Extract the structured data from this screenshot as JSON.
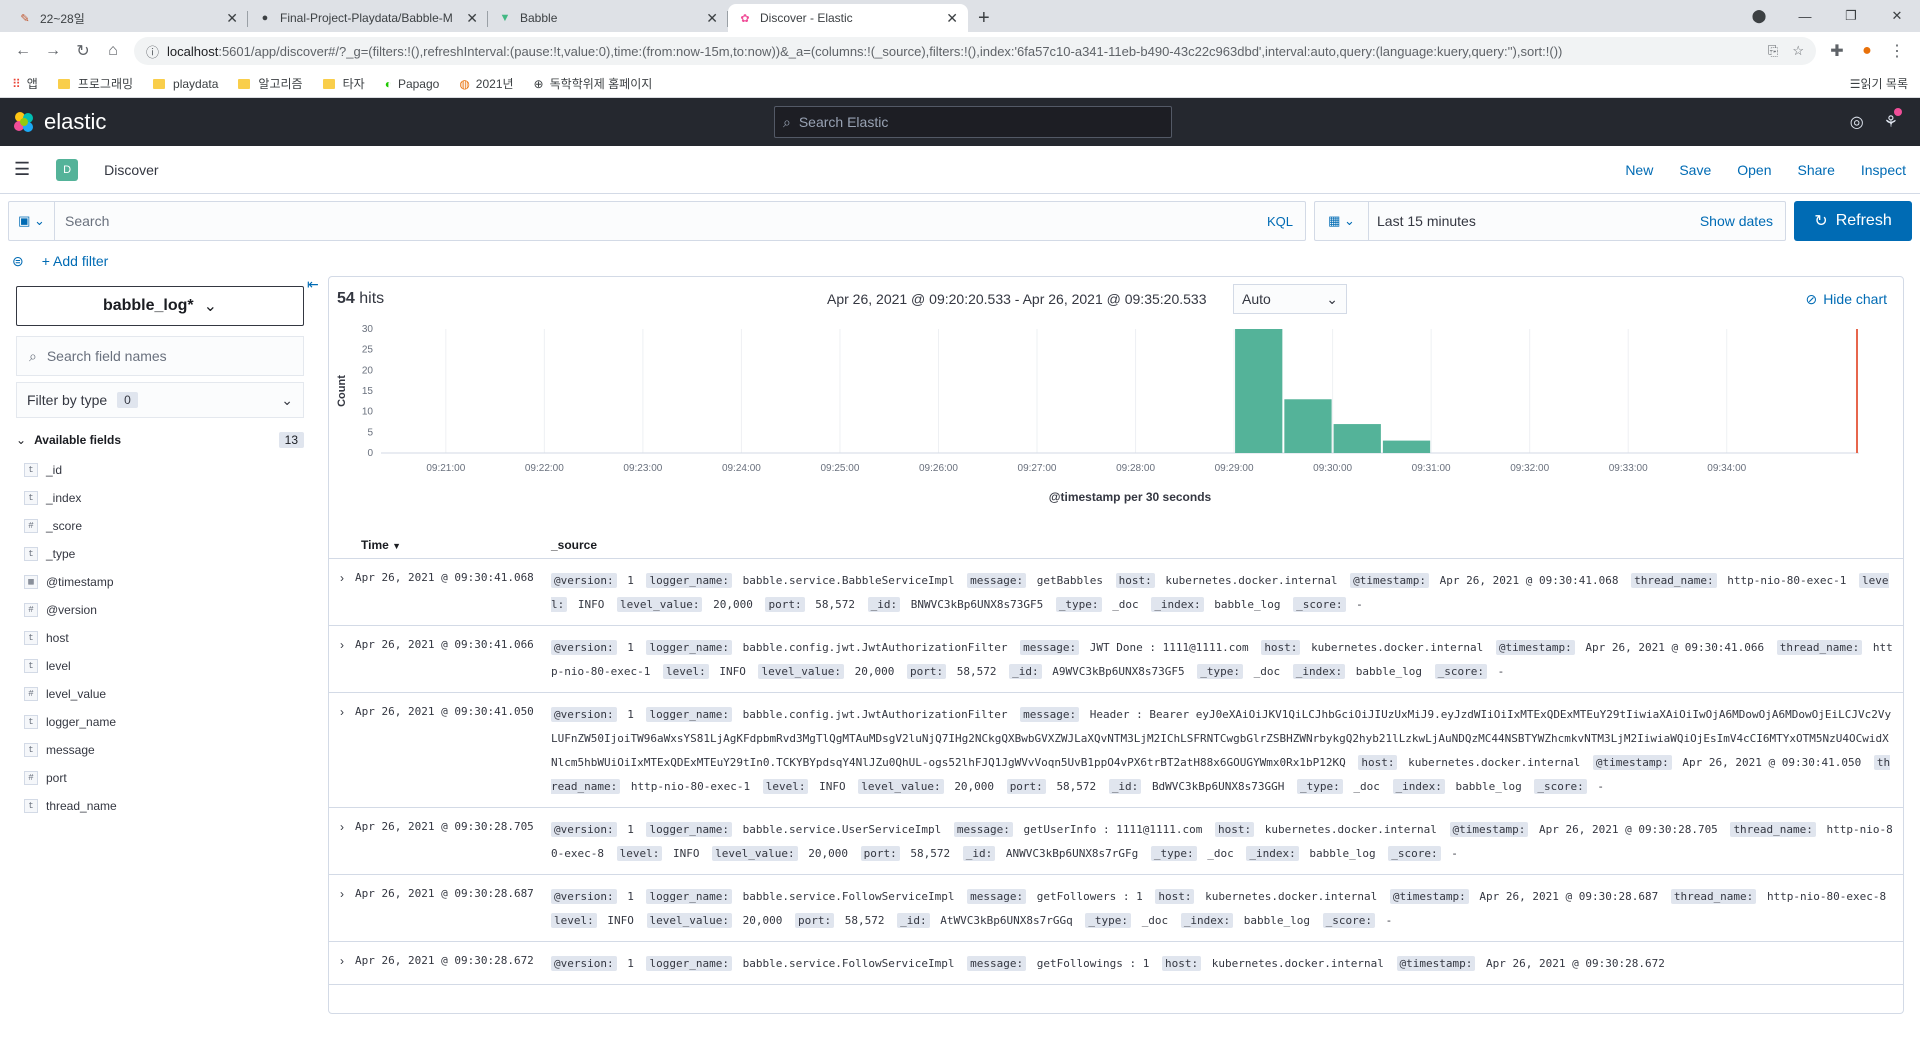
{
  "browser": {
    "tabs": [
      {
        "title": "22~28일",
        "icon": "paint-icon"
      },
      {
        "title": "Final-Project-Playdata/Babble-M",
        "icon": "github-icon"
      },
      {
        "title": "Babble",
        "icon": "vue-icon"
      },
      {
        "title": "Discover - Elastic",
        "icon": "elastic-icon",
        "active": true
      }
    ],
    "url_host": "localhost",
    "url_rest": ":5601/app/discover#/?_g=(filters:!(),refreshInterval:(pause:!t,value:0),time:(from:now-15m,to:now))&_a=(columns:!(_source),filters:!(),index:'6fa57c10-a341-11eb-b490-43c22c963dbd',interval:auto,query:(language:kuery,query:''),sort:!())",
    "bookmarks": [
      "앱",
      "프로그래밍",
      "playdata",
      "알고리즘",
      "타자",
      "Papago",
      "2021년",
      "독학학위제 홈페이지"
    ],
    "reading_list": "읽기 목록"
  },
  "kibana": {
    "logo_text": "elastic",
    "search_placeholder": "Search Elastic",
    "app_badge": "D",
    "breadcrumb": "Discover",
    "top_nav": [
      "New",
      "Save",
      "Open",
      "Share",
      "Inspect"
    ],
    "query_placeholder": "Search",
    "query_language": "KQL",
    "time_range": "Last 15 minutes",
    "show_dates": "Show dates",
    "refresh": "Refresh",
    "add_filter": "+ Add filter"
  },
  "sidebar": {
    "index_pattern": "babble_log*",
    "field_search_placeholder": "Search field names",
    "filter_by_type": "Filter by type",
    "filter_count": "0",
    "available_fields_label": "Available fields",
    "available_count": "13",
    "fields": [
      {
        "type": "t",
        "name": "_id"
      },
      {
        "type": "t",
        "name": "_index"
      },
      {
        "type": "#",
        "name": "_score"
      },
      {
        "type": "t",
        "name": "_type"
      },
      {
        "type": "▦",
        "name": "@timestamp"
      },
      {
        "type": "#",
        "name": "@version"
      },
      {
        "type": "t",
        "name": "host"
      },
      {
        "type": "t",
        "name": "level"
      },
      {
        "type": "#",
        "name": "level_value"
      },
      {
        "type": "t",
        "name": "logger_name"
      },
      {
        "type": "t",
        "name": "message"
      },
      {
        "type": "#",
        "name": "port"
      },
      {
        "type": "t",
        "name": "thread_name"
      }
    ]
  },
  "results": {
    "hits_count": "54",
    "hits_label": "hits",
    "range_text": "Apr 26, 2021 @ 09:20:20.533 - Apr 26, 2021 @ 09:35:20.533",
    "interval": "Auto",
    "hide_chart": "Hide chart",
    "col_time": "Time",
    "col_source": "_source"
  },
  "chart_data": {
    "type": "bar",
    "ylabel": "Count",
    "xlabel": "@timestamp per 30 seconds",
    "ylim": [
      0,
      30
    ],
    "yticks": [
      0,
      5,
      10,
      15,
      20,
      25,
      30
    ],
    "xticks": [
      "09:21:00",
      "09:22:00",
      "09:23:00",
      "09:24:00",
      "09:25:00",
      "09:26:00",
      "09:27:00",
      "09:28:00",
      "09:29:00",
      "09:30:00",
      "09:31:00",
      "09:32:00",
      "09:33:00",
      "09:34:00"
    ],
    "bars": [
      {
        "x": "09:29:00",
        "value": 31
      },
      {
        "x": "09:29:30",
        "value": 13
      },
      {
        "x": "09:30:00",
        "value": 7
      },
      {
        "x": "09:30:30",
        "value": 3
      }
    ],
    "now_marker": "09:35:20.533",
    "color": "#54b399"
  },
  "docs": [
    {
      "time": "Apr 26, 2021 @ 09:30:41.068",
      "fields": [
        [
          "@version:",
          "1"
        ],
        [
          "logger_name:",
          "babble.service.BabbleServiceImpl"
        ],
        [
          "message:",
          "getBabbles"
        ],
        [
          "host:",
          "kubernetes.docker.internal"
        ],
        [
          "@timestamp:",
          "Apr 26, 2021 @ 09:30:41.068"
        ],
        [
          "thread_name:",
          "http-nio-80-exec-1"
        ],
        [
          "level:",
          "INFO"
        ],
        [
          "level_value:",
          "20,000"
        ],
        [
          "port:",
          "58,572"
        ],
        [
          "_id:",
          "BNWVC3kBp6UNX8s73GF5"
        ],
        [
          "_type:",
          "_doc"
        ],
        [
          "_index:",
          "babble_log"
        ],
        [
          "_score:",
          "-"
        ]
      ]
    },
    {
      "time": "Apr 26, 2021 @ 09:30:41.066",
      "fields": [
        [
          "@version:",
          "1"
        ],
        [
          "logger_name:",
          "babble.config.jwt.JwtAuthorizationFilter"
        ],
        [
          "message:",
          "JWT Done : 1111@1111.com"
        ],
        [
          "host:",
          "kubernetes.docker.internal"
        ],
        [
          "@timestamp:",
          "Apr 26, 2021 @ 09:30:41.066"
        ],
        [
          "thread_name:",
          "http-nio-80-exec-1"
        ],
        [
          "level:",
          "INFO"
        ],
        [
          "level_value:",
          "20,000"
        ],
        [
          "port:",
          "58,572"
        ],
        [
          "_id:",
          "A9WVC3kBp6UNX8s73GF5"
        ],
        [
          "_type:",
          "_doc"
        ],
        [
          "_index:",
          "babble_log"
        ],
        [
          "_score:",
          "-"
        ]
      ]
    },
    {
      "time": "Apr 26, 2021 @ 09:30:41.050",
      "fields": [
        [
          "@version:",
          "1"
        ],
        [
          "logger_name:",
          "babble.config.jwt.JwtAuthorizationFilter"
        ],
        [
          "message:",
          "Header : Bearer eyJ0eXAiOiJKV1QiLCJhbGciOiJIUzUxMiJ9.eyJzdWIiOiIxMTExQDExMTEuY29tIiwiaXAiOiIwOjA6MDowOjA6MDowOjEiLCJVc2VyLUFnZW50IjoiTW96aWxsYS81LjAgKFdpbmRvd3MgTlQgMTAuMDsgV2luNjQ7IHg2NCkgQXBwbGVXZWJLaXQvNTM3LjM2IChLSFRNTCwgbGlrZSBHZWNrbykgQ2hyb21lLzkwLjAuNDQzMC44NSBTYWZhcmkvNTM3LjM2IiwiaWQiOjEsImV4cCI6MTYxOTM5NzU4OCwidXNlcm5hbWUiOiIxMTExQDExMTEuY29tIn0.TCKYBYpdsqY4NlJZu0QhUL-ogs52lhFJQ1JgWVvVoqn5UvB1ppO4vPX6trBT2atH88x6GOUGYWmx0Rx1bP12KQ"
        ],
        [
          "host:",
          "kubernetes.docker.internal"
        ],
        [
          "@timestamp:",
          "Apr 26, 2021 @ 09:30:41.050"
        ],
        [
          "thread_name:",
          "http-nio-80-exec-1"
        ],
        [
          "level:",
          "INFO"
        ],
        [
          "level_value:",
          "20,000"
        ],
        [
          "port:",
          "58,572"
        ],
        [
          "_id:",
          "BdWVC3kBp6UNX8s73GGH"
        ],
        [
          "_type:",
          "_doc"
        ],
        [
          "_index:",
          "babble_log"
        ],
        [
          "_score:",
          "-"
        ]
      ]
    },
    {
      "time": "Apr 26, 2021 @ 09:30:28.705",
      "fields": [
        [
          "@version:",
          "1"
        ],
        [
          "logger_name:",
          "babble.service.UserServiceImpl"
        ],
        [
          "message:",
          "getUserInfo : 1111@1111.com"
        ],
        [
          "host:",
          "kubernetes.docker.internal"
        ],
        [
          "@timestamp:",
          "Apr 26, 2021 @ 09:30:28.705"
        ],
        [
          "thread_name:",
          "http-nio-80-exec-8"
        ],
        [
          "level:",
          "INFO"
        ],
        [
          "level_value:",
          "20,000"
        ],
        [
          "port:",
          "58,572"
        ],
        [
          "_id:",
          "ANWVC3kBp6UNX8s7rGFg"
        ],
        [
          "_type:",
          "_doc"
        ],
        [
          "_index:",
          "babble_log"
        ],
        [
          "_score:",
          "-"
        ]
      ]
    },
    {
      "time": "Apr 26, 2021 @ 09:30:28.687",
      "fields": [
        [
          "@version:",
          "1"
        ],
        [
          "logger_name:",
          "babble.service.FollowServiceImpl"
        ],
        [
          "message:",
          "getFollowers : 1"
        ],
        [
          "host:",
          "kubernetes.docker.internal"
        ],
        [
          "@timestamp:",
          "Apr 26, 2021 @ 09:30:28.687"
        ],
        [
          "thread_name:",
          "http-nio-80-exec-8"
        ],
        [
          "level:",
          "INFO"
        ],
        [
          "level_value:",
          "20,000"
        ],
        [
          "port:",
          "58,572"
        ],
        [
          "_id:",
          "AtWVC3kBp6UNX8s7rGGq"
        ],
        [
          "_type:",
          "_doc"
        ],
        [
          "_index:",
          "babble_log"
        ],
        [
          "_score:",
          "-"
        ]
      ]
    },
    {
      "time": "Apr 26, 2021 @ 09:30:28.672",
      "fields": [
        [
          "@version:",
          "1"
        ],
        [
          "logger_name:",
          "babble.service.FollowServiceImpl"
        ],
        [
          "message:",
          "getFollowings : 1"
        ],
        [
          "host:",
          "kubernetes.docker.internal"
        ],
        [
          "@timestamp:",
          "Apr 26, 2021 @ 09:30:28.672"
        ]
      ]
    }
  ]
}
